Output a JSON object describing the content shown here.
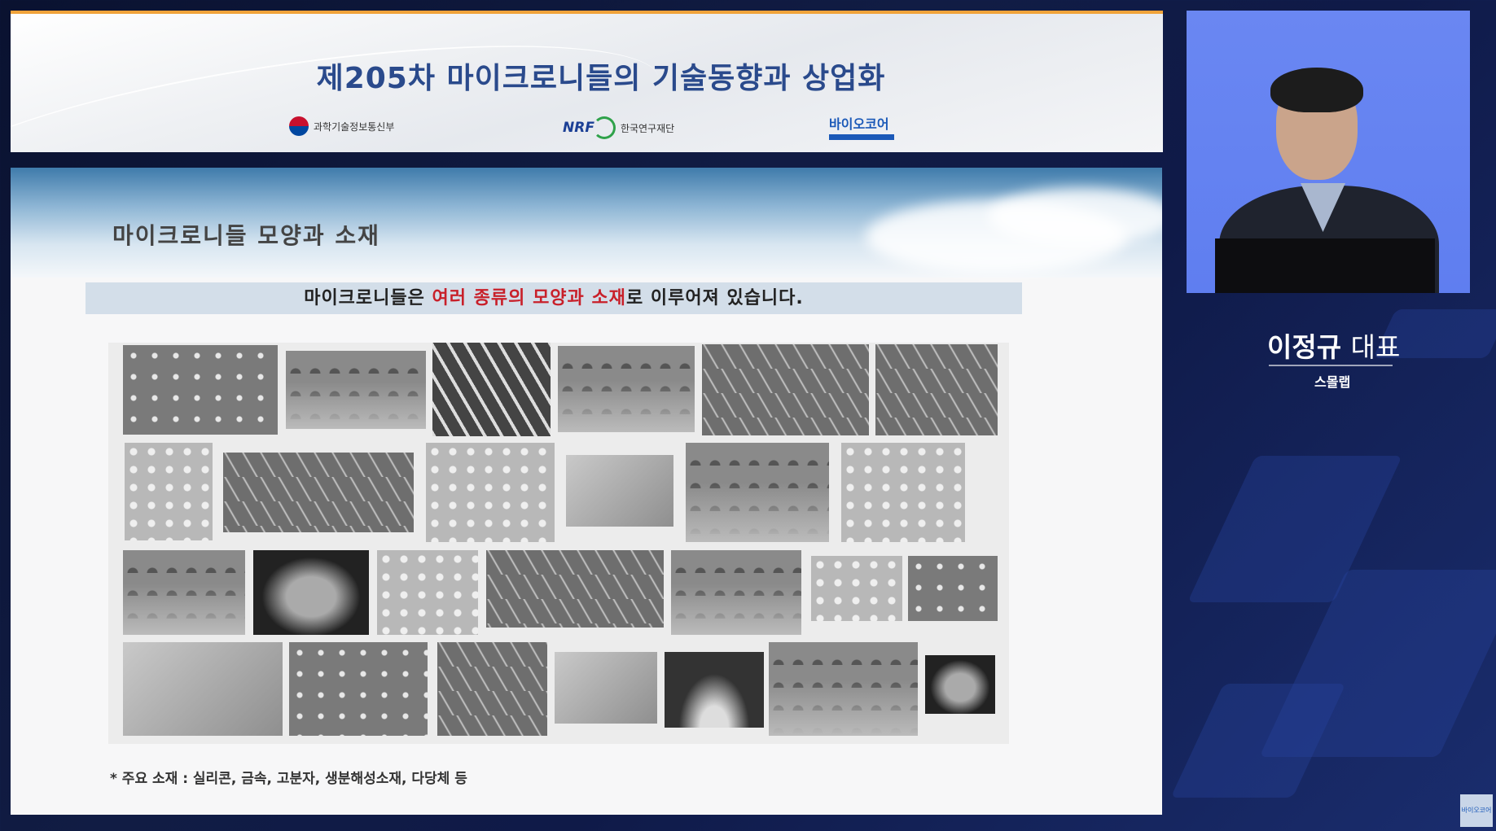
{
  "header": {
    "title": "제205차 마이크로니들의 기술동향과 상업화",
    "logos": {
      "msit": "과학기술정보통신부",
      "nrf_mark": "NRF",
      "nrf": "한국연구재단",
      "bio": "바이오코어"
    }
  },
  "slide": {
    "title": "마이크로니들 모양과 소재",
    "subtitle": {
      "prefix": "마이크로니들은 ",
      "highlight": "여러 종류의 모양과 소재",
      "suffix": "로 이루어져 있습니다."
    },
    "footnote": "* 주요 소재 : 실리콘, 금속, 고분자, 생분해성소재, 다당체 등"
  },
  "speaker": {
    "name": "이정규",
    "rank": "대표",
    "org": "스몰랩"
  },
  "colors": {
    "title_blue": "#2a4a8c",
    "highlight_red": "#c8202a",
    "speaker_bg": "#6a87f2",
    "accent_orange": "#f0a33a"
  }
}
